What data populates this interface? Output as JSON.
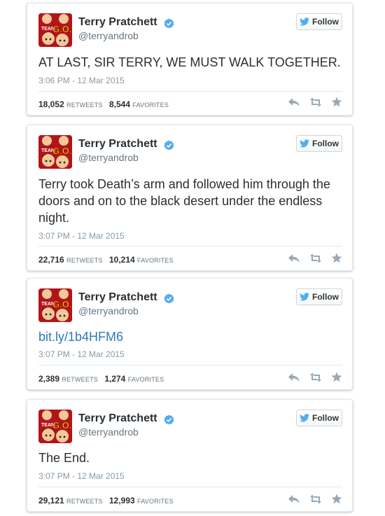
{
  "colors": {
    "accent": "#55acee",
    "link": "#2b7bb9",
    "verified": "#55acee",
    "action_icon": "#99a8b4"
  },
  "tweets": [
    {
      "display_name": "Terry Pratchett",
      "handle": "@terryandrob",
      "follow_label": "Follow",
      "text": "AT LAST, SIR TERRY, WE MUST WALK TOGETHER.",
      "timestamp": "3:06 PM - 12 Mar 2015",
      "retweets": "18,052",
      "retweets_label": "RETWEETS",
      "favorites": "8,544",
      "favorites_label": "FAVORITES",
      "icons": [
        "reply-icon",
        "retweet-icon",
        "favorite-icon"
      ]
    },
    {
      "display_name": "Terry Pratchett",
      "handle": "@terryandrob",
      "follow_label": "Follow",
      "text": "Terry took Death’s arm and followed him through the doors and on to the black desert under the endless night.",
      "timestamp": "3:07 PM - 12 Mar 2015",
      "retweets": "22,716",
      "retweets_label": "RETWEETS",
      "favorites": "10,214",
      "favorites_label": "FAVORITES",
      "icons": [
        "reply-icon",
        "retweet-icon",
        "favorite-icon"
      ]
    },
    {
      "display_name": "Terry Pratchett",
      "handle": "@terryandrob",
      "follow_label": "Follow",
      "text": "bit.ly/1b4HFM6",
      "timestamp": "3:07 PM - 12 Mar 2015",
      "retweets": "2,389",
      "retweets_label": "RETWEETS",
      "favorites": "1,274",
      "favorites_label": "FAVORITES",
      "icons": [
        "reply-icon",
        "retweet-icon",
        "favorite-icon"
      ]
    },
    {
      "display_name": "Terry Pratchett",
      "handle": "@terryandrob",
      "follow_label": "Follow",
      "text": "The End.",
      "timestamp": "3:07 PM - 12 Mar 2015",
      "retweets": "29,121",
      "retweets_label": "RETWEETS",
      "favorites": "12,993",
      "favorites_label": "FAVORITES",
      "icons": [
        "reply-icon",
        "retweet-icon",
        "favorite-icon"
      ]
    }
  ],
  "avatar": {
    "logo_text_a": "TEAM",
    "logo_text_b": "G.O."
  }
}
